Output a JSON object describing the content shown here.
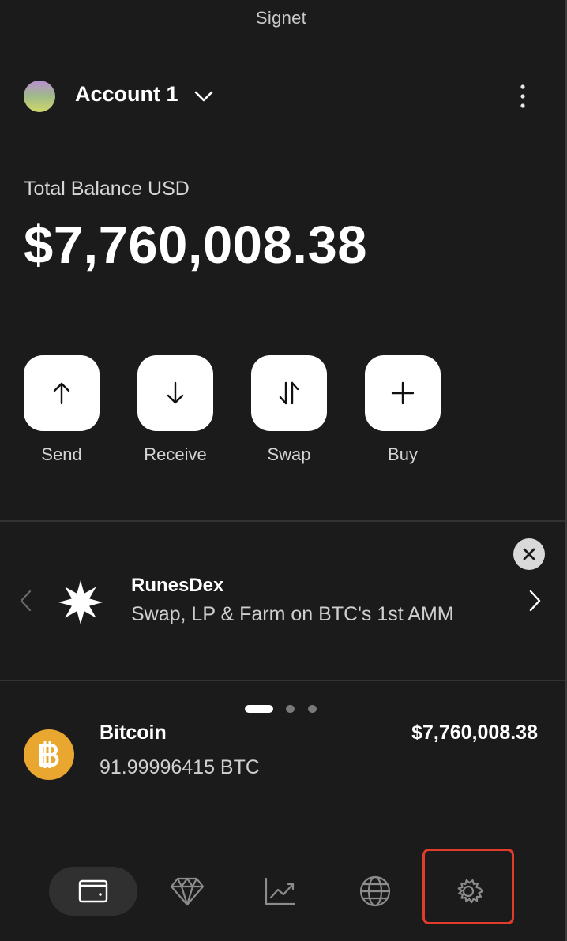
{
  "header": {
    "network": "Signet"
  },
  "account": {
    "name": "Account 1",
    "icon_dropdown": "chevron-down-icon",
    "icon_menu": "kebab-menu-icon"
  },
  "balance": {
    "label": "Total Balance USD",
    "value": "$7,760,008.38"
  },
  "actions": [
    {
      "label": "Send",
      "icon": "arrow-up-icon"
    },
    {
      "label": "Receive",
      "icon": "arrow-down-icon"
    },
    {
      "label": "Swap",
      "icon": "swap-icon"
    },
    {
      "label": "Buy",
      "icon": "plus-icon"
    }
  ],
  "banner": {
    "title": "RunesDex",
    "subtitle": "Swap, LP & Farm on BTC's 1st AMM",
    "icon": "runesdex-star-icon",
    "active_page": 1,
    "page_count": 3
  },
  "assets": [
    {
      "name": "Bitcoin",
      "amount": "91.99996415 BTC",
      "value": "$7,760,008.38",
      "icon": "bitcoin-icon"
    }
  ],
  "bottom_nav": [
    {
      "id": "wallet",
      "icon": "wallet-icon",
      "active": true
    },
    {
      "id": "collectibles",
      "icon": "diamond-icon",
      "active": false
    },
    {
      "id": "stacking",
      "icon": "chart-icon",
      "active": false
    },
    {
      "id": "explore",
      "icon": "globe-icon",
      "active": false
    },
    {
      "id": "settings",
      "icon": "gear-icon",
      "active": false,
      "highlighted": true
    }
  ],
  "colors": {
    "background": "#1b1b1b",
    "bitcoin": "#eaa72f",
    "highlight": "#df3c2c",
    "action_button": "#ffffff"
  }
}
